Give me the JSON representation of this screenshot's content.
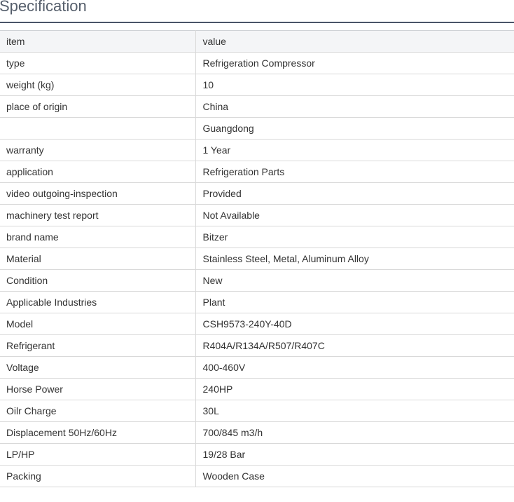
{
  "title": "Specification",
  "columns": {
    "item": "item",
    "value": "value"
  },
  "rows": [
    {
      "item": "type",
      "value": "Refrigeration Compressor"
    },
    {
      "item": "weight (kg)",
      "value": "10"
    },
    {
      "item": "place of origin",
      "value": "China"
    },
    {
      "item": "",
      "value": "Guangdong"
    },
    {
      "item": "warranty",
      "value": "1 Year"
    },
    {
      "item": "application",
      "value": "Refrigeration Parts"
    },
    {
      "item": "video outgoing-inspection",
      "value": "Provided"
    },
    {
      "item": "machinery test report",
      "value": "Not Available"
    },
    {
      "item": "brand name",
      "value": "Bitzer"
    },
    {
      "item": "Material",
      "value": "Stainless Steel, Metal, Aluminum Alloy"
    },
    {
      "item": "Condition",
      "value": "New"
    },
    {
      "item": "Applicable Industries",
      "value": "Plant"
    },
    {
      "item": "Model",
      "value": "CSH9573-240Y-40D"
    },
    {
      "item": "Refrigerant",
      "value": "R404A/R134A/R507/R407C"
    },
    {
      "item": "Voltage",
      "value": "400-460V"
    },
    {
      "item": "Horse Power",
      "value": "240HP"
    },
    {
      "item": "Oilr Charge",
      "value": "30L"
    },
    {
      "item": "Displacement 50Hz/60Hz",
      "value": "700/845 m3/h"
    },
    {
      "item": "LP/HP",
      "value": "19/28 Bar"
    },
    {
      "item": "Packing",
      "value": "Wooden Case"
    }
  ]
}
